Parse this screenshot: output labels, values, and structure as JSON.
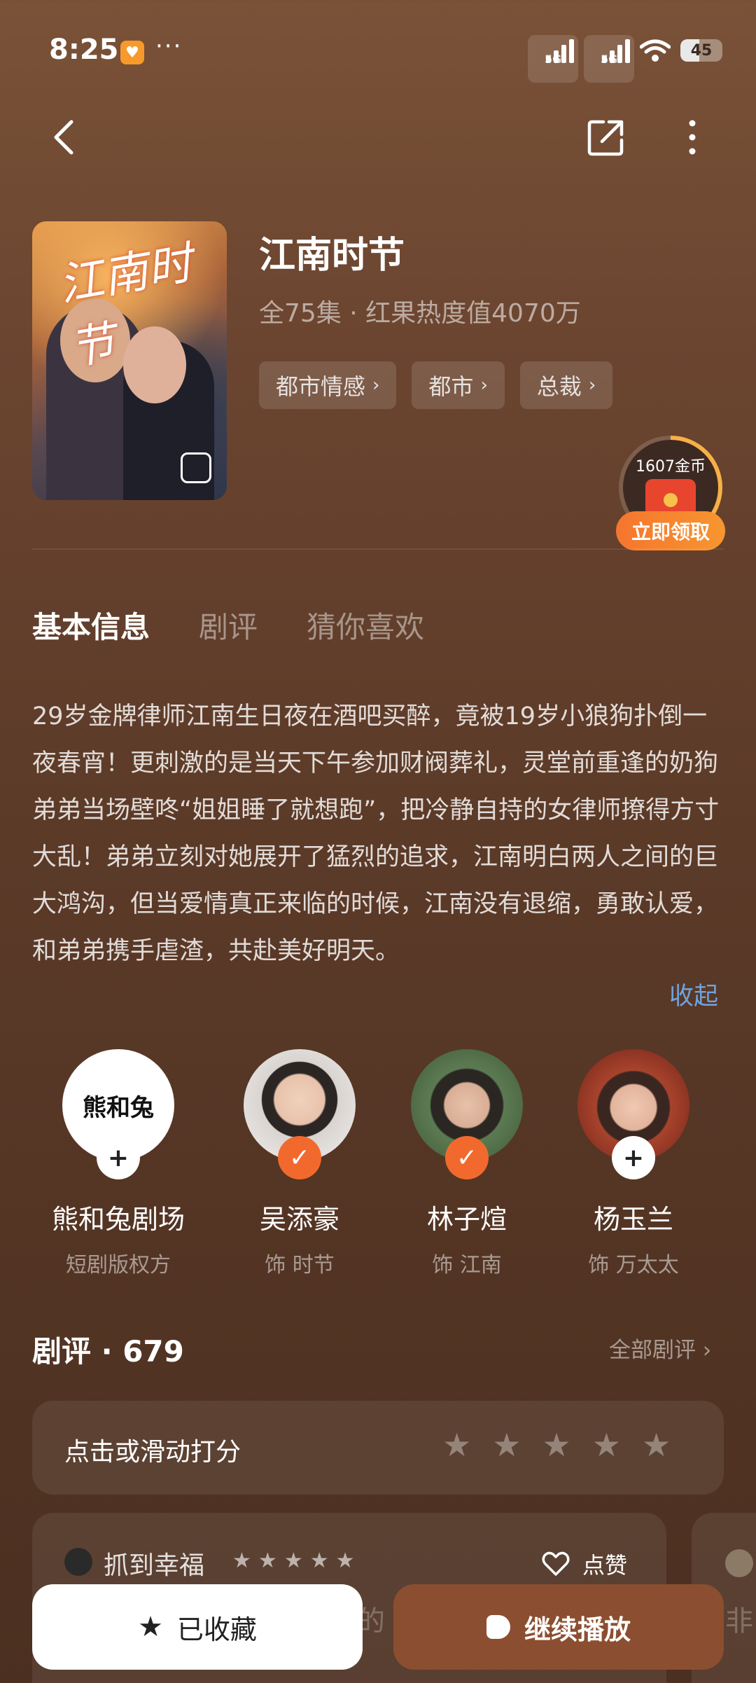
{
  "status_bar": {
    "time": "8:25",
    "dots": "···",
    "signal1_label": "5G",
    "signal2_label": "5G",
    "battery": "45"
  },
  "show": {
    "title": "江南时节",
    "poster_title": "江南时节",
    "meta": "全75集 · 红果热度值4070万",
    "tags": [
      "都市情感",
      "都市",
      "总裁"
    ]
  },
  "coin_widget": {
    "amount": "1607金币",
    "button": "立即领取"
  },
  "tabs": [
    "基本信息",
    "剧评",
    "猜你喜欢"
  ],
  "synopsis": "29岁金牌律师江南生日夜在酒吧买醉，竟被19岁小狼狗扑倒一夜春宵！更刺激的是当天下午参加财阀葬礼，灵堂前重逢的奶狗弟弟当场壁咚“姐姐睡了就想跑”，把冷静自持的女律师撩得方寸大乱！弟弟立刻对她展开了猛烈的追求，江南明白两人之间的巨大鸿沟，但当爱情真正来临的时候，江南没有退缩，勇敢认爱，和弟弟携手虐渣，共赴美好明天。",
  "collapse_label": "收起",
  "cast": [
    {
      "name": "熊和兔剧场",
      "role": "短剧版权方",
      "badge": "+",
      "logo": "熊和兔"
    },
    {
      "name": "吴添豪",
      "role": "饰 时节",
      "badge": "✓"
    },
    {
      "name": "林子煊",
      "role": "饰 江南",
      "badge": "✓"
    },
    {
      "name": "杨玉兰",
      "role": "饰 万太太",
      "badge": "+"
    }
  ],
  "reviews": {
    "title": "剧评 · 679",
    "all_label": "全部剧评 ›",
    "rate_prompt": "点击或滑动打分",
    "first": {
      "user": "抓到幸福",
      "rating": 5,
      "like_label": "点赞",
      "faded_text": "的",
      "faded_text2": "非"
    }
  },
  "bottom": {
    "collected_label": "已收藏",
    "play_label": "继续播放"
  },
  "colors": {
    "accent": "#f2692e",
    "link": "#6fa3e0",
    "play_button": "#8c4e30"
  }
}
